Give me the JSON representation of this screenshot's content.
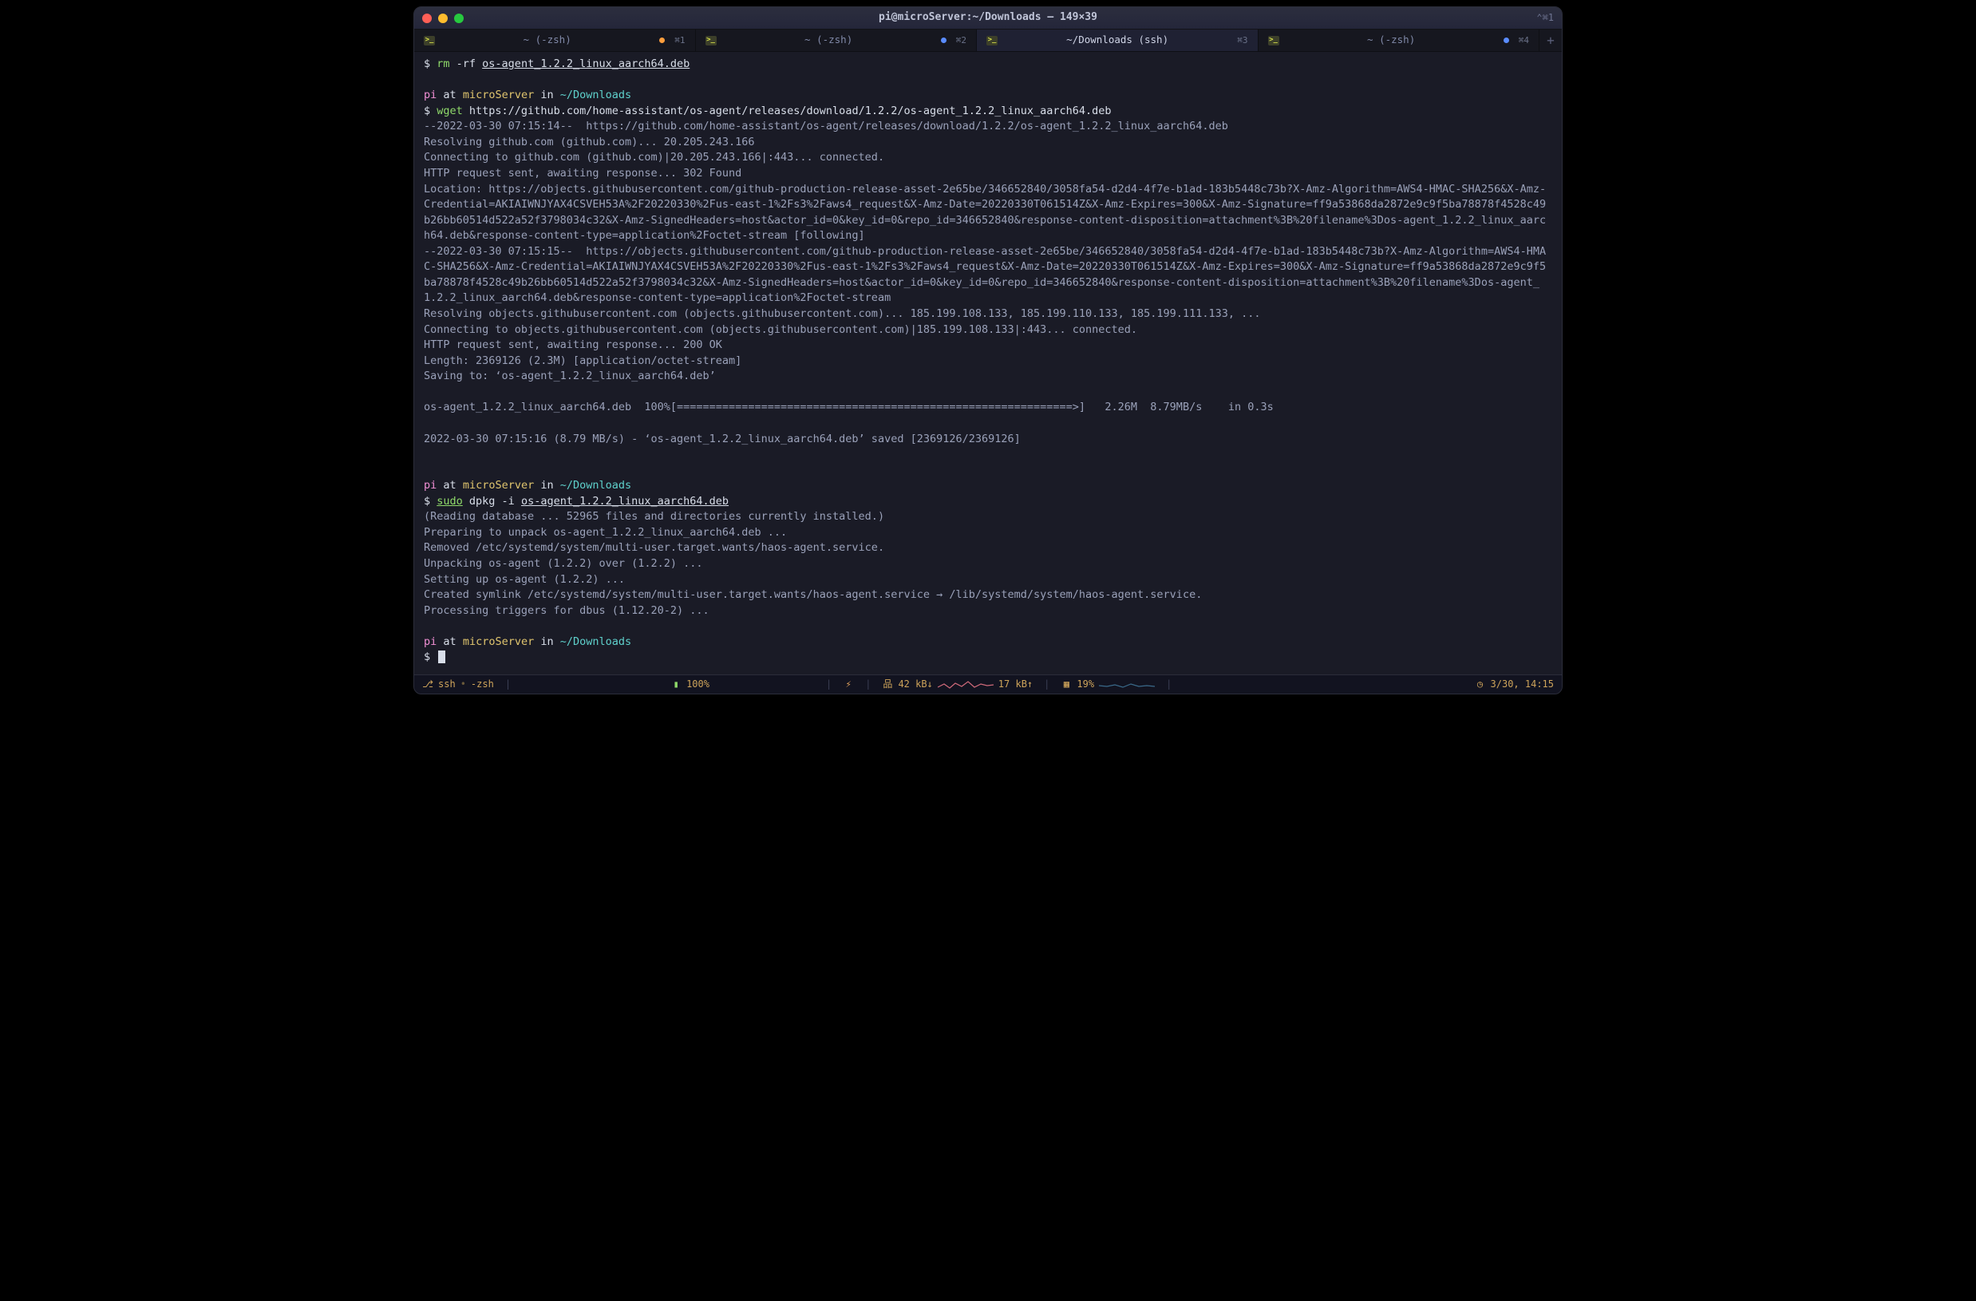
{
  "window": {
    "title": "pi@microServer:~/Downloads — 149×39",
    "broadcast": "⌃⌘1"
  },
  "tabs": [
    {
      "label": "~ (-zsh)",
      "short": "⌘1",
      "active": false,
      "dot": "orange"
    },
    {
      "label": "~ (-zsh)",
      "short": "⌘2",
      "active": false,
      "dot": "blue"
    },
    {
      "label": "~/Downloads (ssh)",
      "short": "⌘3",
      "active": true,
      "dot": null
    },
    {
      "label": "~ (-zsh)",
      "short": "⌘4",
      "active": false,
      "dot": "blue"
    }
  ],
  "prompt": {
    "user": "pi",
    "at": "at",
    "host": "microServer",
    "in": "in",
    "path": "~/Downloads",
    "dollar": "$"
  },
  "blocks": [
    {
      "type": "cmd",
      "parts": [
        {
          "t": "rm",
          "cls": "c-green"
        },
        {
          "t": " -rf ",
          "cls": "c-white"
        },
        {
          "t": "os-agent_1.2.2_linux_aarch64.deb",
          "cls": "c-white u"
        }
      ]
    },
    {
      "type": "blank"
    },
    {
      "type": "promptline"
    },
    {
      "type": "cmd",
      "parts": [
        {
          "t": "wget",
          "cls": "c-green"
        },
        {
          "t": " https://github.com/home-assistant/os-agent/releases/download/1.2.2/os-agent_1.2.2_linux_aarch64.deb",
          "cls": "c-white"
        }
      ]
    },
    {
      "type": "out",
      "text": "--2022-03-30 07:15:14--  https://github.com/home-assistant/os-agent/releases/download/1.2.2/os-agent_1.2.2_linux_aarch64.deb"
    },
    {
      "type": "out",
      "text": "Resolving github.com (github.com)... 20.205.243.166"
    },
    {
      "type": "out",
      "text": "Connecting to github.com (github.com)|20.205.243.166|:443... connected."
    },
    {
      "type": "out",
      "text": "HTTP request sent, awaiting response... 302 Found"
    },
    {
      "type": "out",
      "text": "Location: https://objects.githubusercontent.com/github-production-release-asset-2e65be/346652840/3058fa54-d2d4-4f7e-b1ad-183b5448c73b?X-Amz-Algorithm=AWS4-HMAC-SHA256&X-Amz-Credential=AKIAIWNJYAX4CSVEH53A%2F20220330%2Fus-east-1%2Fs3%2Faws4_request&X-Amz-Date=20220330T061514Z&X-Amz-Expires=300&X-Amz-Signature=ff9a53868da2872e9c9f5ba78878f4528c49b26bb60514d522a52f3798034c32&X-Amz-SignedHeaders=host&actor_id=0&key_id=0&repo_id=346652840&response-content-disposition=attachment%3B%20filename%3Dos-agent_1.2.2_linux_aarch64.deb&response-content-type=application%2Foctet-stream [following]"
    },
    {
      "type": "out",
      "text": "--2022-03-30 07:15:15--  https://objects.githubusercontent.com/github-production-release-asset-2e65be/346652840/3058fa54-d2d4-4f7e-b1ad-183b5448c73b?X-Amz-Algorithm=AWS4-HMAC-SHA256&X-Amz-Credential=AKIAIWNJYAX4CSVEH53A%2F20220330%2Fus-east-1%2Fs3%2Faws4_request&X-Amz-Date=20220330T061514Z&X-Amz-Expires=300&X-Amz-Signature=ff9a53868da2872e9c9f5ba78878f4528c49b26bb60514d522a52f3798034c32&X-Amz-SignedHeaders=host&actor_id=0&key_id=0&repo_id=346652840&response-content-disposition=attachment%3B%20filename%3Dos-agent_1.2.2_linux_aarch64.deb&response-content-type=application%2Foctet-stream"
    },
    {
      "type": "out",
      "text": "Resolving objects.githubusercontent.com (objects.githubusercontent.com)... 185.199.108.133, 185.199.110.133, 185.199.111.133, ..."
    },
    {
      "type": "out",
      "text": "Connecting to objects.githubusercontent.com (objects.githubusercontent.com)|185.199.108.133|:443... connected."
    },
    {
      "type": "out",
      "text": "HTTP request sent, awaiting response... 200 OK"
    },
    {
      "type": "out",
      "text": "Length: 2369126 (2.3M) [application/octet-stream]"
    },
    {
      "type": "out",
      "text": "Saving to: ‘os-agent_1.2.2_linux_aarch64.deb’"
    },
    {
      "type": "blank"
    },
    {
      "type": "out",
      "text": "os-agent_1.2.2_linux_aarch64.deb  100%[=============================================================>]   2.26M  8.79MB/s    in 0.3s"
    },
    {
      "type": "blank"
    },
    {
      "type": "out",
      "text": "2022-03-30 07:15:16 (8.79 MB/s) - ‘os-agent_1.2.2_linux_aarch64.deb’ saved [2369126/2369126]"
    },
    {
      "type": "blank"
    },
    {
      "type": "blank"
    },
    {
      "type": "promptline"
    },
    {
      "type": "cmd",
      "parts": [
        {
          "t": "sudo",
          "cls": "c-green u"
        },
        {
          "t": " dpkg -i ",
          "cls": "c-white"
        },
        {
          "t": "os-agent_1.2.2_linux_aarch64.deb",
          "cls": "c-white u"
        }
      ]
    },
    {
      "type": "out",
      "text": "(Reading database ... 52965 files and directories currently installed.)"
    },
    {
      "type": "out",
      "text": "Preparing to unpack os-agent_1.2.2_linux_aarch64.deb ..."
    },
    {
      "type": "out",
      "text": "Removed /etc/systemd/system/multi-user.target.wants/haos-agent.service."
    },
    {
      "type": "out",
      "text": "Unpacking os-agent (1.2.2) over (1.2.2) ..."
    },
    {
      "type": "out",
      "text": "Setting up os-agent (1.2.2) ..."
    },
    {
      "type": "out",
      "text": "Created symlink /etc/systemd/system/multi-user.target.wants/haos-agent.service → /lib/systemd/system/haos-agent.service."
    },
    {
      "type": "out",
      "text": "Processing triggers for dbus (1.12.20-2) ..."
    },
    {
      "type": "blank"
    },
    {
      "type": "promptline"
    },
    {
      "type": "cursor"
    }
  ],
  "status": {
    "left1": "ssh",
    "left2": "-zsh",
    "battery": "100%",
    "net_down": "42 kB↓",
    "net_up": "17 kB↑",
    "cpu": "19%",
    "clock": "3/30, 14:15"
  }
}
